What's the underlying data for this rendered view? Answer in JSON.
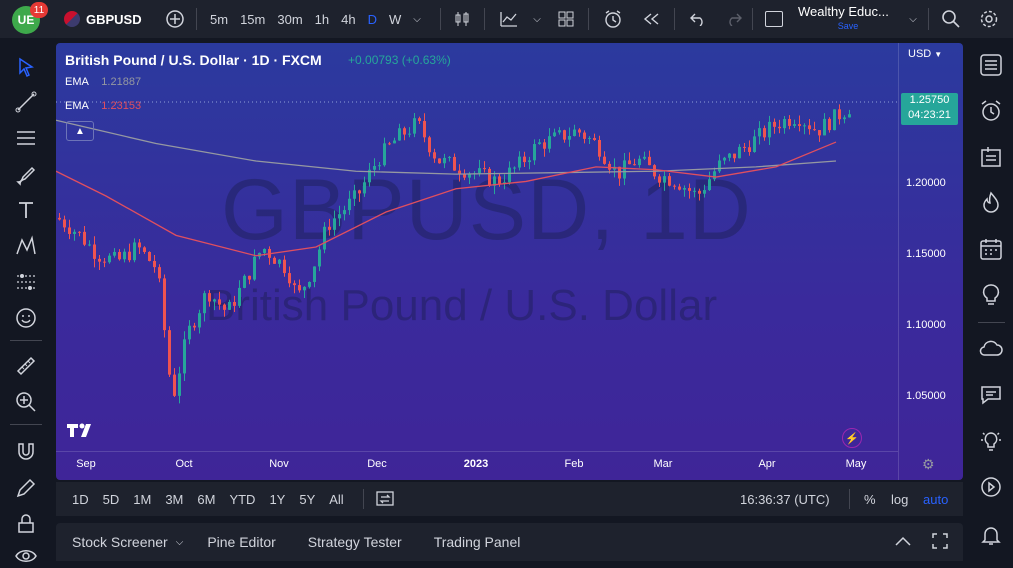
{
  "header": {
    "notifications": "11",
    "symbol": "GBPUSD",
    "intervals": [
      "5m",
      "15m",
      "30m",
      "1h",
      "4h",
      "D",
      "W"
    ],
    "active_interval": "D",
    "layout_name": "Wealthy Educ...",
    "save_label": "Save"
  },
  "legend": {
    "title": "British Pound / U.S. Dollar · 1D · FXCM",
    "change": "+0.00793 (+0.63%)",
    "ema1_label": "EMA",
    "ema1_value": "1.21887",
    "ema2_label": "EMA",
    "ema2_value": "1.23153"
  },
  "watermark": {
    "line1": "GBPUSD, 1D",
    "line2": "British Pound / U.S. Dollar"
  },
  "price_axis": {
    "currency": "USD",
    "last_price": "1.25750",
    "countdown": "04:23:21"
  },
  "chart_data": {
    "type": "candlestick",
    "x_labels": [
      "Sep",
      "Oct",
      "Nov",
      "Dec",
      "2023",
      "Feb",
      "Mar",
      "Apr",
      "May"
    ],
    "y_ticks": [
      "1.20000",
      "1.15000",
      "1.10000",
      "1.05000"
    ],
    "ylim": [
      1.02,
      1.3
    ],
    "last_price": 1.2575,
    "series": [
      {
        "name": "EMA",
        "value": 1.21887,
        "color": "#9598a1",
        "points": [
          [
            0,
            1.247
          ],
          [
            100,
            1.231
          ],
          [
            200,
            1.219
          ],
          [
            300,
            1.212
          ],
          [
            400,
            1.21
          ],
          [
            500,
            1.211
          ],
          [
            600,
            1.212
          ],
          [
            700,
            1.215
          ],
          [
            780,
            1.219
          ]
        ]
      },
      {
        "name": "EMA",
        "value": 1.23153,
        "color": "#e04f5f",
        "points": [
          [
            0,
            1.212
          ],
          [
            50,
            1.195
          ],
          [
            120,
            1.168
          ],
          [
            200,
            1.154
          ],
          [
            260,
            1.16
          ],
          [
            330,
            1.184
          ],
          [
            400,
            1.2
          ],
          [
            470,
            1.205
          ],
          [
            540,
            1.215
          ],
          [
            600,
            1.213
          ],
          [
            660,
            1.208
          ],
          [
            720,
            1.215
          ],
          [
            780,
            1.232
          ]
        ]
      }
    ],
    "close_path": [
      [
        0,
        1.18
      ],
      [
        20,
        1.17
      ],
      [
        40,
        1.155
      ],
      [
        60,
        1.15
      ],
      [
        80,
        1.16
      ],
      [
        100,
        1.145
      ],
      [
        110,
        1.085
      ],
      [
        115,
        1.055
      ],
      [
        130,
        1.1
      ],
      [
        150,
        1.13
      ],
      [
        170,
        1.115
      ],
      [
        190,
        1.14
      ],
      [
        205,
        1.16
      ],
      [
        230,
        1.145
      ],
      [
        240,
        1.125
      ],
      [
        255,
        1.145
      ],
      [
        270,
        1.175
      ],
      [
        300,
        1.195
      ],
      [
        320,
        1.22
      ],
      [
        340,
        1.235
      ],
      [
        360,
        1.245
      ],
      [
        380,
        1.22
      ],
      [
        400,
        1.215
      ],
      [
        420,
        1.21
      ],
      [
        440,
        1.205
      ],
      [
        460,
        1.215
      ],
      [
        480,
        1.23
      ],
      [
        500,
        1.235
      ],
      [
        520,
        1.24
      ],
      [
        540,
        1.23
      ],
      [
        560,
        1.21
      ],
      [
        580,
        1.22
      ],
      [
        600,
        1.21
      ],
      [
        620,
        1.205
      ],
      [
        640,
        1.195
      ],
      [
        660,
        1.215
      ],
      [
        680,
        1.225
      ],
      [
        700,
        1.235
      ],
      [
        720,
        1.245
      ],
      [
        740,
        1.25
      ],
      [
        760,
        1.24
      ],
      [
        780,
        1.25
      ],
      [
        795,
        1.2575
      ]
    ],
    "colors": {
      "up": "#26a69a",
      "down": "#ef5350"
    }
  },
  "time_axis": {
    "labels": [
      "Sep",
      "Oct",
      "Nov",
      "Dec",
      "2023",
      "Feb",
      "Mar",
      "Apr",
      "May"
    ]
  },
  "bottom_toolbar": {
    "ranges": [
      "1D",
      "5D",
      "1M",
      "3M",
      "6M",
      "YTD",
      "1Y",
      "5Y",
      "All"
    ],
    "clock": "16:36:37 (UTC)",
    "percent": "%",
    "log": "log",
    "auto": "auto"
  },
  "panels": {
    "items": [
      "Stock Screener",
      "Pine Editor",
      "Strategy Tester",
      "Trading Panel"
    ]
  },
  "colors": {
    "accent": "#2962ff",
    "up": "#26a69a",
    "down": "#ef5350"
  }
}
